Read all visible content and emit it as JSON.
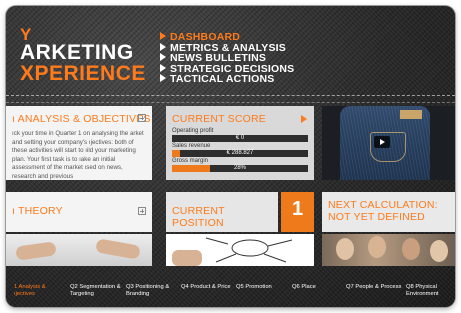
{
  "header": {
    "logo_lines": [
      "Y",
      "ARKETING",
      "XPERIENCE"
    ],
    "nav": [
      {
        "label": "DASHBOARD",
        "active": true
      },
      {
        "label": "METRICS & ANALYSIS",
        "active": false
      },
      {
        "label": "NEWS BULLETINS",
        "active": false
      },
      {
        "label": "STRATEGIC DECISIONS",
        "active": false
      },
      {
        "label": "TACTICAL ACTIONS",
        "active": false
      }
    ]
  },
  "tiles": {
    "analysis": {
      "title": "ı ANALYSIS & OBJECTIVES",
      "body": "ıck your time in Quarter 1 on analysing the arket and setting your company's ıjectives: both of these activities will start to ıild your marketing plan. Your first task is to ıake an initial assessment of the market ısed on news, research and previous"
    },
    "score": {
      "title": "CURRENT SCORE",
      "metrics": [
        {
          "label": "Operating profit",
          "value": "€ 0",
          "fill": 0.0
        },
        {
          "label": "Sales revenue",
          "value": "€ 288.827",
          "fill": 0.06
        },
        {
          "label": "Gross margin",
          "value": "28%",
          "fill": 0.28
        }
      ]
    },
    "theory": {
      "title": "ı THEORY"
    },
    "position": {
      "title": "CURRENT POSITION",
      "number": "1"
    },
    "next": {
      "title_lines": [
        "NEXT CALCULATION:",
        "NOT YET DEFINED"
      ]
    }
  },
  "tabs": [
    {
      "lines": [
        "1 Analysis &",
        "ıjectives"
      ],
      "active": true
    },
    {
      "lines": [
        "Q2 Segmentation &",
        "Targeting"
      ],
      "active": false
    },
    {
      "lines": [
        "Q3 Positioning &",
        "Branding"
      ],
      "active": false
    },
    {
      "lines": [
        "Q4 Product & Price",
        ""
      ],
      "active": false
    },
    {
      "lines": [
        "Q5 Promotion",
        ""
      ],
      "active": false
    },
    {
      "lines": [
        "Q6 Place",
        ""
      ],
      "active": false
    },
    {
      "lines": [
        "Q7 People & Process",
        ""
      ],
      "active": false
    },
    {
      "lines": [
        "Q8 Physical",
        "Environment"
      ],
      "active": false
    }
  ],
  "colors": {
    "accent": "#ff7a1a",
    "background": "#2b2b2b",
    "tile": "#f4f4f4"
  }
}
